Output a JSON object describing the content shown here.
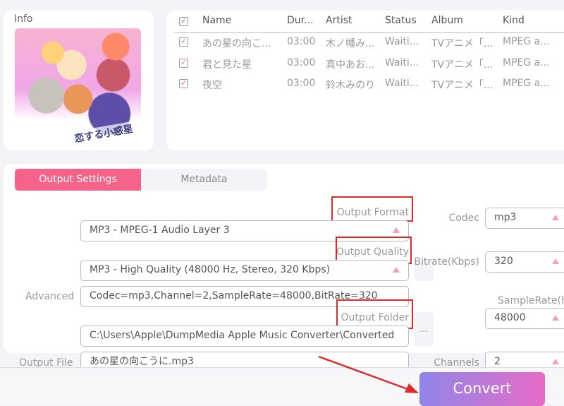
{
  "info": {
    "title": "Info",
    "cover_logo": "恋する小惑星"
  },
  "tracks": {
    "columns": [
      "Name",
      "Dur...",
      "Artist",
      "Status",
      "Album",
      "Kind"
    ],
    "rows": [
      {
        "checked": true,
        "name": "あの星の向こ...",
        "duration": "03:00",
        "artist": "木ノ幡み...",
        "status": "Waiti...",
        "album": "TVアニメ「...",
        "kind": "MPEG a..."
      },
      {
        "checked": true,
        "name": "君と見た星",
        "duration": "03:00",
        "artist": "真中あお...",
        "status": "Waiti...",
        "album": "TVアニメ「...",
        "kind": "MPEG a..."
      },
      {
        "checked": true,
        "name": "夜空",
        "duration": "03:00",
        "artist": "鈴木みのり",
        "status": "Waiti...",
        "album": "TVアニメ「...",
        "kind": "MPEG a..."
      }
    ]
  },
  "tabs": {
    "output_settings": "Output Settings",
    "metadata": "Metadata",
    "active": "Output Settings"
  },
  "settings": {
    "output_format_label": "Output Format",
    "output_format": "MP3 - MPEG-1 Audio Layer 3",
    "output_quality_label": "Output Quality",
    "output_quality": "MP3 - High Quality (48000 Hz, Stereo, 320 Kbps)",
    "advanced_label": "Advanced",
    "advanced": "Codec=mp3,Channel=2,SampleRate=48000,BitRate=320",
    "output_folder_label": "Output Folder",
    "output_folder": "C:\\Users\\Apple\\DumpMedia Apple Music Converter\\Converted",
    "browse_label": "...",
    "output_file_label": "Output File",
    "output_file": "あの星の向こうに.mp3",
    "codec_label": "Codec",
    "codec": "mp3",
    "bitrate_label": "Bitrate(Kbps)",
    "bitrate": "320",
    "samplerate_label": "SampleRate(h",
    "samplerate": "48000",
    "channels_label": "Channels",
    "channels": "2"
  },
  "convert_label": "Convert",
  "colors": {
    "accent": "#f5638a",
    "annotation": "#e02a2a",
    "convert_start": "#8f86e8",
    "convert_end": "#e86bc8"
  }
}
